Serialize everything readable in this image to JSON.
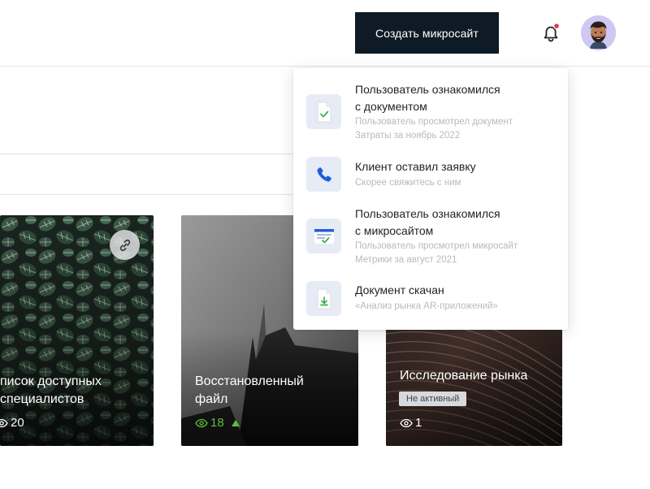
{
  "header": {
    "create_button": "Создать микросайт",
    "bell_icon": "bell-icon",
    "avatar_icon": "user-avatar"
  },
  "cards": [
    {
      "title": "писок доступных специалистов",
      "views": "20",
      "action_icon": "link-icon"
    },
    {
      "title": "Восстановленный файл",
      "views": "18",
      "trend_icon": "arrow-up-icon"
    },
    {
      "title": "Исследование рынка",
      "badge": "Не активный",
      "views": "1"
    }
  ],
  "notifications": [
    {
      "icon": "document-check-icon",
      "title_line1": "Пользователь ознакомился",
      "title_line2": "с документом",
      "desc_line1": "Пользователь просмотрел документ",
      "desc_line2": "Затраты за ноябрь 2022"
    },
    {
      "icon": "phone-icon",
      "title_line1": "Клиент оставил заявку",
      "desc_line1": "Скорее свяжитесь с ним"
    },
    {
      "icon": "microsite-check-icon",
      "title_line1": "Пользователь ознакомился",
      "title_line2": "с микросайтом",
      "desc_line1": "Пользователь просмотрел микросайт",
      "desc_line2": "Метрики за август 2021"
    },
    {
      "icon": "document-download-icon",
      "title_line1": "Документ скачан",
      "desc_line1": "«Анализ рынка AR-приложений»"
    }
  ],
  "colors": {
    "primary_dark": "#0e1a26",
    "notification_dot": "#e5354a",
    "views_positive": "#5fbf3a",
    "phone_blue": "#1e5fd8",
    "check_green": "#36b24a"
  }
}
